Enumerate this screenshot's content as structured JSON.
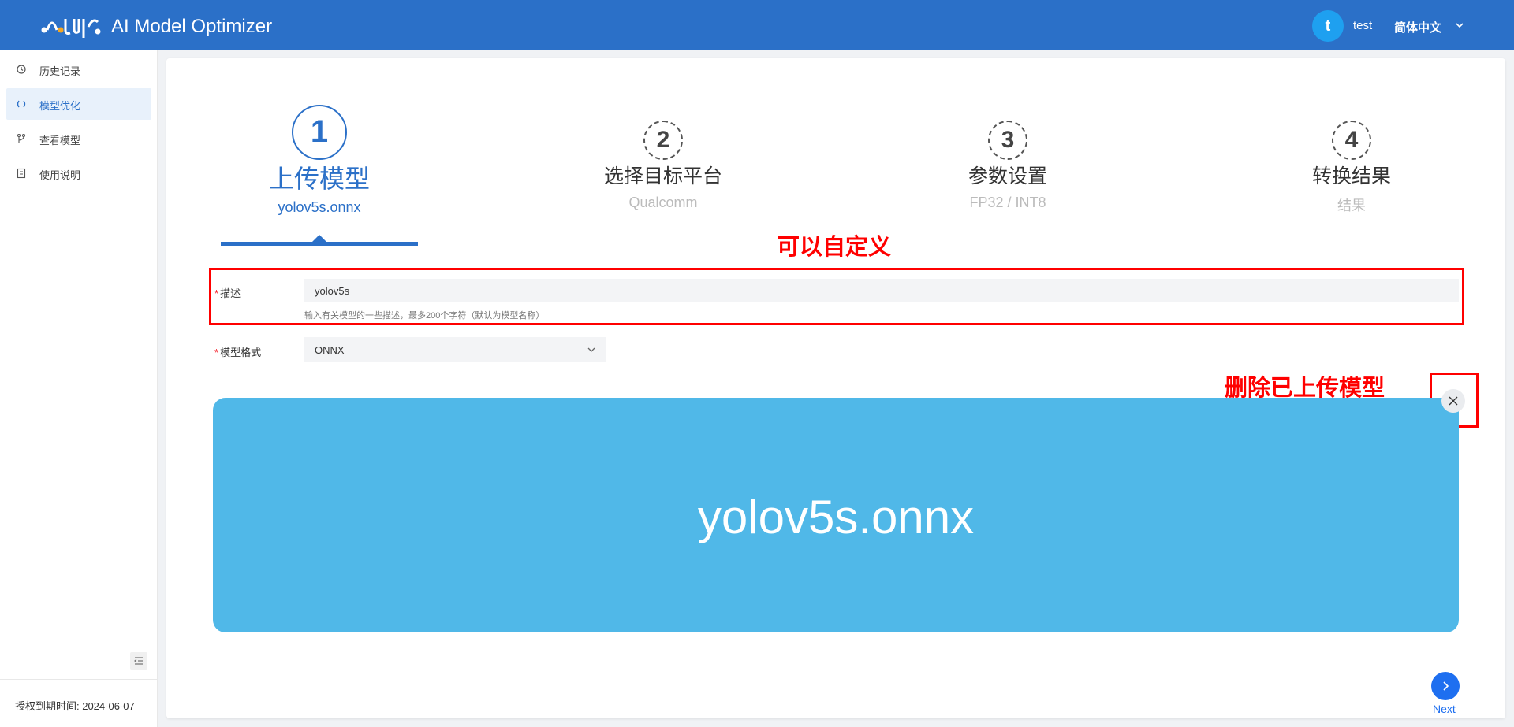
{
  "header": {
    "app_title": "AI Model Optimizer",
    "avatar_letter": "t",
    "username": "test",
    "language": "简体中文"
  },
  "sidebar": {
    "items": [
      {
        "label": "历史记录",
        "icon": "history-icon"
      },
      {
        "label": "模型优化",
        "icon": "optimize-icon",
        "active": true
      },
      {
        "label": "查看模型",
        "icon": "branch-icon"
      },
      {
        "label": "使用说明",
        "icon": "doc-icon"
      }
    ],
    "license_text": "授权到期时间: 2024-06-07"
  },
  "steps": [
    {
      "number": "1",
      "title": "上传模型",
      "subtitle": "yolov5s.onnx",
      "active": true
    },
    {
      "number": "2",
      "title": "选择目标平台",
      "subtitle": "Qualcomm"
    },
    {
      "number": "3",
      "title": "参数设置",
      "subtitle": "FP32 / INT8"
    },
    {
      "number": "4",
      "title": "转换结果",
      "subtitle": "结果"
    }
  ],
  "form": {
    "description": {
      "label": "描述",
      "value": "yolov5s",
      "hint": "输入有关模型的一些描述，最多200个字符（默认为模型名称）"
    },
    "format": {
      "label": "模型格式",
      "value": "ONNX"
    }
  },
  "model_card": {
    "name": "yolov5s.onnx"
  },
  "annotations": {
    "customizable": "可以自定义",
    "delete_uploaded": "删除已上传模型"
  },
  "next": {
    "label": "Next"
  },
  "colors": {
    "brand": "#2b70c8",
    "card": "#50b8e8",
    "annotation": "#ff0000",
    "next": "#1e6ff0"
  }
}
